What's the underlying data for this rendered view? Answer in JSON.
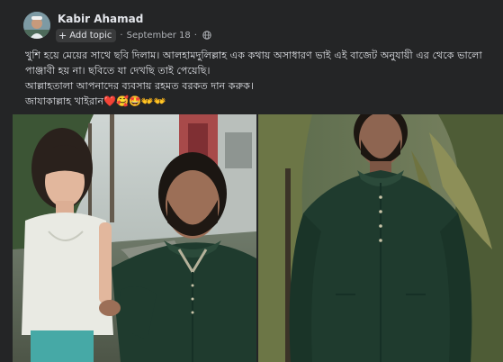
{
  "post": {
    "author": {
      "name": "Kabir Ahamad",
      "avatar": "profile-photo"
    },
    "add_topic_label": "Add topic",
    "separator": "·",
    "date": "September 18",
    "privacy_icon": "globe-icon",
    "text": {
      "line1": "খুশি হয়ে মেয়ের সাথে ছবি দিলাম। আলহামদুলিল্লাহ এক কথায় অসাধারণ ভাই এই বাজেট অনুযায়ী এর থেকে ভালো পাঞ্জাবী হয় না। ছবিতে যা দেখছি তাই পেয়েছি।",
      "line2": "আল্লাহতালা আপনাদের ব্যবসায় রহমত বরকত দান করুক।",
      "line3": "জাযাকাল্লাহ খাইরান❤️🥰🤩👐👐"
    },
    "photos": [
      {
        "name": "selfie-with-daughter"
      },
      {
        "name": "man-in-green-panjabi"
      }
    ]
  },
  "colors": {
    "background": "#242526",
    "text_primary": "#e4e6eb",
    "text_secondary": "#b0b3b8",
    "button_bg": "#3a3b3c",
    "panjabi_green": "#1f3b2e"
  }
}
